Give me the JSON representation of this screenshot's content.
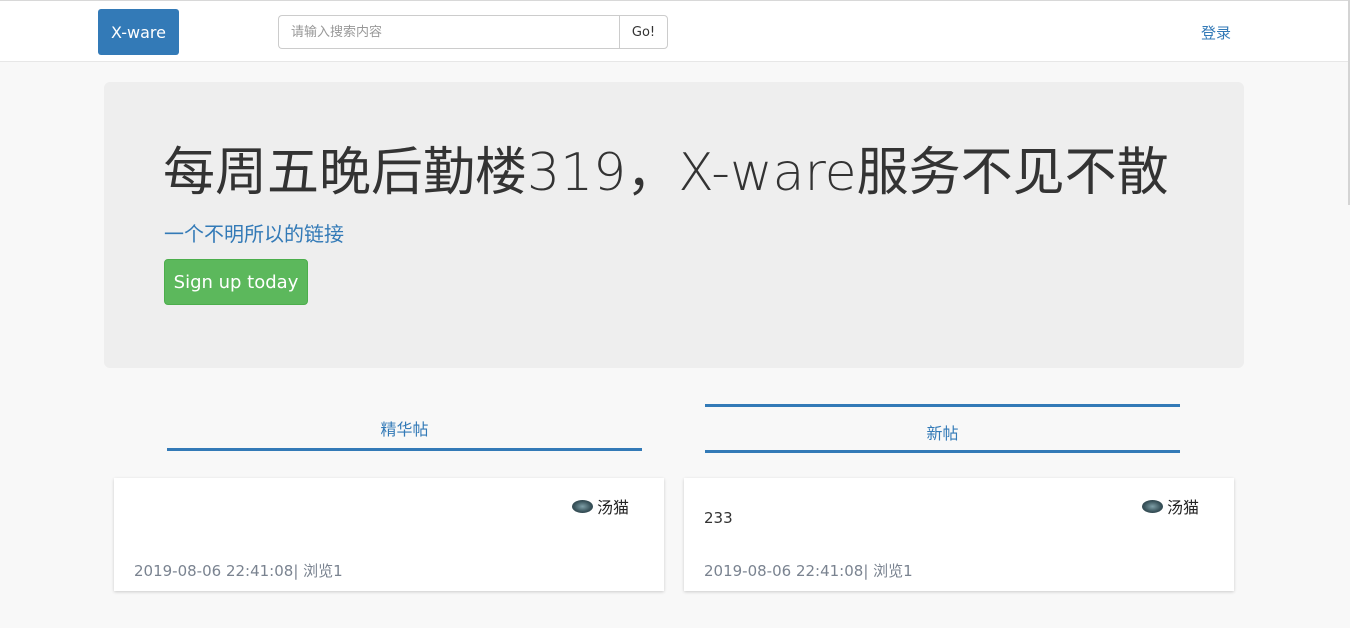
{
  "navbar": {
    "brand": "X-ware",
    "search_placeholder": "请输入搜索内容",
    "search_button": "Go!",
    "login": "登录"
  },
  "jumbotron": {
    "title": "每周五晚后勤楼319，X-ware服务不见不散",
    "link": "一个不明所以的链接",
    "button": "Sign up today"
  },
  "tabs": {
    "featured": "精华帖",
    "new": "新帖"
  },
  "posts": [
    {
      "author": "汤猫",
      "body": "",
      "time": "2019-08-06 22:41:08",
      "views": "| 浏览1"
    },
    {
      "author": "汤猫",
      "body": "233",
      "time": "2019-08-06 22:41:08",
      "views": "| 浏览1"
    }
  ],
  "colors": {
    "primary": "#337ab7",
    "success": "#5cb85c",
    "jumbotron": "#eeeeee"
  }
}
